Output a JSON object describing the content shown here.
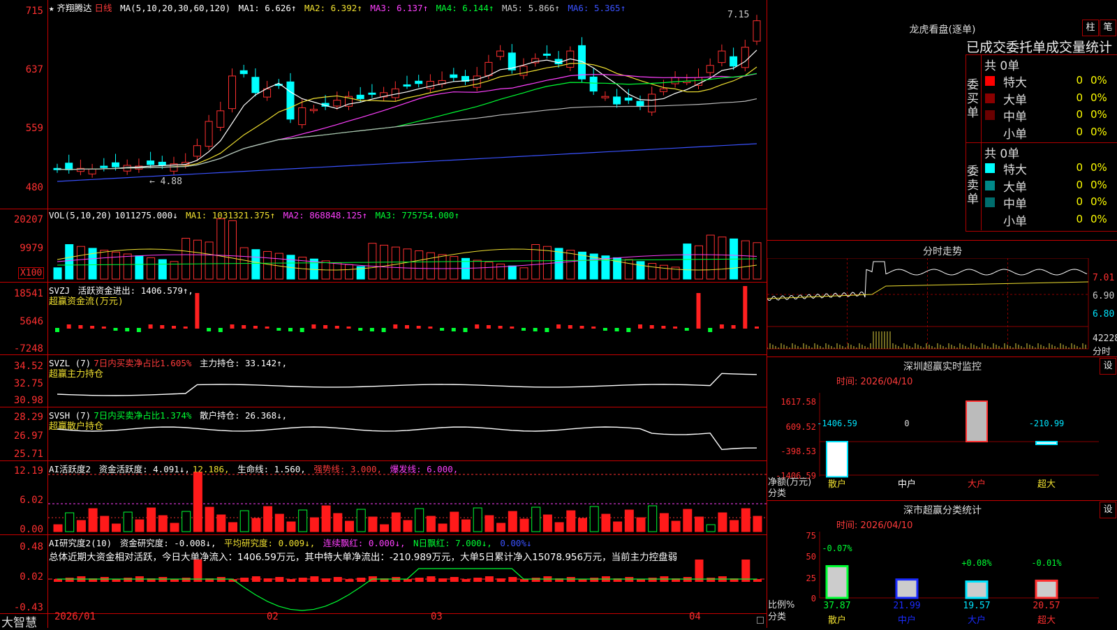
{
  "stock": {
    "star": "★",
    "name": "齐翔腾达",
    "period": "日线"
  },
  "main_header": {
    "ma_params": "MA(5,10,20,30,60,120)",
    "ma": [
      {
        "label": "MA1: 6.626↑",
        "color": "#ffffff"
      },
      {
        "label": "MA2: 6.392↑",
        "color": "#f0e030"
      },
      {
        "label": "MA3: 6.137↑",
        "color": "#ff40ff"
      },
      {
        "label": "MA4: 6.144↑",
        "color": "#00ff33"
      },
      {
        "label": "MA5: 5.866↑",
        "color": "#cccccc"
      },
      {
        "label": "MA6: 5.365↑",
        "color": "#3a52ff"
      }
    ],
    "high_mark": "7.15",
    "low_mark": "← 4.88"
  },
  "y_labels": {
    "price": [
      "715",
      "637",
      "559",
      "480"
    ],
    "vol": [
      "20207",
      "9979",
      "X100"
    ],
    "svzj": [
      "18541",
      "5646",
      "-7248"
    ],
    "svzl": [
      "34.52",
      "32.75",
      "30.98"
    ],
    "svsh": [
      "28.29",
      "26.97",
      "25.71"
    ],
    "ai1": [
      "12.19",
      "6.02",
      "0.00"
    ],
    "ai2": [
      "0.48",
      "0.02",
      "-0.43"
    ]
  },
  "vol_header": {
    "name": "VOL(5,10,20)",
    "value": "1011275.000↓",
    "ma1": "MA1: 1031321.375↑",
    "ma2": "MA2: 868848.125↑",
    "ma3": "MA3: 775754.000↑"
  },
  "svzj_header": {
    "name": "SVZJ",
    "label": "活跃资金进出: 1406.579↑,",
    "sub": "超赢资金流(万元)"
  },
  "svzl_header": {
    "name": "SVZL (7)",
    "label1": "7日内买卖净占比1.605%",
    "label2": "主力持仓: 33.142↑,",
    "sub": "超赢主力持仓"
  },
  "svsh_header": {
    "name": "SVSH (7)",
    "label1": "7日内买卖净占比1.374%",
    "label2": "散户持仓: 26.368↓,",
    "sub": "超赢散户持仓"
  },
  "ai1_header": {
    "name": "AI活跃度2",
    "l1": "资金活跃度: 4.091↓,",
    "l2": "12.186,",
    "l3": "生命线: 1.560,",
    "l4": "强势线: 3.000,",
    "l5": "爆发线: 6.000,"
  },
  "ai2_header": {
    "name": "AI研究度2(10)",
    "l1": "资金研究度: -0.008↓,",
    "l2": "平均研究度: 0.009↓,",
    "l3": "连续飘红: 0.000↓,",
    "l4": "N日飘红: 7.000↓,",
    "l5": "0.00%↓",
    "summary": "总体近期大资金相对活跃，今日大单净流入：1406.59万元，其中特大单净流出：-210.989万元，大单5日累计净入15078.956万元，当前主力控盘弱"
  },
  "x_axis": {
    "brand": "大智慧",
    "labels": [
      "2026/01",
      "02",
      "03",
      "04"
    ]
  },
  "dragon": {
    "title": "龙虎看盘(逐单)",
    "btn1": "柱",
    "btn2": "笔",
    "subtitle": "已成交委托单成交量统计",
    "buy_label": "委买单",
    "sell_label": "委卖单",
    "buy_total": "共 0单",
    "sell_total": "共 0单",
    "buy_rows": [
      {
        "name": "特大",
        "n": "0",
        "p": "0%",
        "color": "#ff0000"
      },
      {
        "name": "大单",
        "n": "0",
        "p": "0%",
        "color": "#8b0000"
      },
      {
        "name": "中单",
        "n": "0",
        "p": "0%",
        "color": "#6a0000"
      },
      {
        "name": "小单",
        "n": "0",
        "p": "0%",
        "color": ""
      }
    ],
    "sell_rows": [
      {
        "name": "特大",
        "n": "0",
        "p": "0%",
        "color": "#00ffff"
      },
      {
        "name": "大单",
        "n": "0",
        "p": "0%",
        "color": "#008888"
      },
      {
        "name": "中单",
        "n": "0",
        "p": "0%",
        "color": "#006d6d"
      },
      {
        "name": "小单",
        "n": "0",
        "p": "0%",
        "color": ""
      }
    ]
  },
  "intraday": {
    "title": "分时走势",
    "y": [
      "7.01",
      "6.90",
      "6.80"
    ],
    "vol": "42228",
    "vol_unit": "分时"
  },
  "sz_monitor": {
    "title": "深圳超赢实时监控",
    "btn": "设",
    "time": "时间: 2026/04/10",
    "y": [
      "1617.58",
      "609.52",
      "-398.53",
      "-1406.59"
    ],
    "ylabel": "净额(万元)",
    "xlabel": "分类",
    "cats": [
      "散户",
      "中户",
      "大户",
      "超大"
    ],
    "values": [
      "-1406.59",
      "0",
      "1617.58",
      "-210.99"
    ]
  },
  "sz_class": {
    "title": "深市超赢分类统计",
    "btn": "设",
    "time": "时间: 2026/04/10",
    "y": [
      "75",
      "50",
      "25",
      "0"
    ],
    "ylabel": "比例%",
    "xlabel": "分类",
    "cats": [
      "散户",
      "中户",
      "大户",
      "超大"
    ],
    "top": [
      "-0.07%",
      "",
      "+0.08%",
      "-0.01%"
    ],
    "values": [
      "37.87",
      "21.99",
      "19.57",
      "20.57"
    ]
  },
  "chart_data": {
    "type": "bar",
    "title": "深市超赢分类统计",
    "categories": [
      "散户",
      "中户",
      "大户",
      "超大"
    ],
    "series": [
      {
        "name": "净额(万元)",
        "values": [
          -1406.59,
          0,
          1617.58,
          -210.99
        ]
      },
      {
        "name": "比例%",
        "values": [
          37.87,
          21.99,
          19.57,
          20.57
        ]
      }
    ]
  }
}
